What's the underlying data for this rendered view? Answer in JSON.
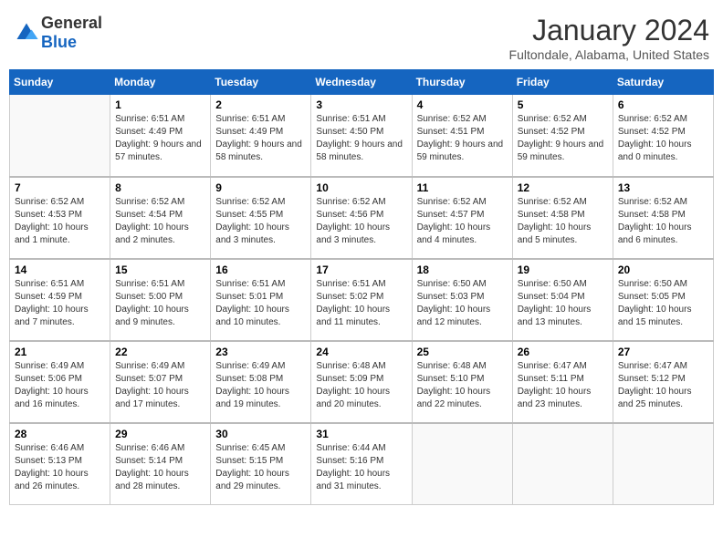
{
  "header": {
    "logo": {
      "general": "General",
      "blue": "Blue"
    },
    "title": "January 2024",
    "location": "Fultondale, Alabama, United States"
  },
  "days_of_week": [
    "Sunday",
    "Monday",
    "Tuesday",
    "Wednesday",
    "Thursday",
    "Friday",
    "Saturday"
  ],
  "weeks": [
    [
      {
        "day": "",
        "sunrise": "",
        "sunset": "",
        "daylight": ""
      },
      {
        "day": "1",
        "sunrise": "Sunrise: 6:51 AM",
        "sunset": "Sunset: 4:49 PM",
        "daylight": "Daylight: 9 hours and 57 minutes."
      },
      {
        "day": "2",
        "sunrise": "Sunrise: 6:51 AM",
        "sunset": "Sunset: 4:49 PM",
        "daylight": "Daylight: 9 hours and 58 minutes."
      },
      {
        "day": "3",
        "sunrise": "Sunrise: 6:51 AM",
        "sunset": "Sunset: 4:50 PM",
        "daylight": "Daylight: 9 hours and 58 minutes."
      },
      {
        "day": "4",
        "sunrise": "Sunrise: 6:52 AM",
        "sunset": "Sunset: 4:51 PM",
        "daylight": "Daylight: 9 hours and 59 minutes."
      },
      {
        "day": "5",
        "sunrise": "Sunrise: 6:52 AM",
        "sunset": "Sunset: 4:52 PM",
        "daylight": "Daylight: 9 hours and 59 minutes."
      },
      {
        "day": "6",
        "sunrise": "Sunrise: 6:52 AM",
        "sunset": "Sunset: 4:52 PM",
        "daylight": "Daylight: 10 hours and 0 minutes."
      }
    ],
    [
      {
        "day": "7",
        "sunrise": "Sunrise: 6:52 AM",
        "sunset": "Sunset: 4:53 PM",
        "daylight": "Daylight: 10 hours and 1 minute."
      },
      {
        "day": "8",
        "sunrise": "Sunrise: 6:52 AM",
        "sunset": "Sunset: 4:54 PM",
        "daylight": "Daylight: 10 hours and 2 minutes."
      },
      {
        "day": "9",
        "sunrise": "Sunrise: 6:52 AM",
        "sunset": "Sunset: 4:55 PM",
        "daylight": "Daylight: 10 hours and 3 minutes."
      },
      {
        "day": "10",
        "sunrise": "Sunrise: 6:52 AM",
        "sunset": "Sunset: 4:56 PM",
        "daylight": "Daylight: 10 hours and 3 minutes."
      },
      {
        "day": "11",
        "sunrise": "Sunrise: 6:52 AM",
        "sunset": "Sunset: 4:57 PM",
        "daylight": "Daylight: 10 hours and 4 minutes."
      },
      {
        "day": "12",
        "sunrise": "Sunrise: 6:52 AM",
        "sunset": "Sunset: 4:58 PM",
        "daylight": "Daylight: 10 hours and 5 minutes."
      },
      {
        "day": "13",
        "sunrise": "Sunrise: 6:52 AM",
        "sunset": "Sunset: 4:58 PM",
        "daylight": "Daylight: 10 hours and 6 minutes."
      }
    ],
    [
      {
        "day": "14",
        "sunrise": "Sunrise: 6:51 AM",
        "sunset": "Sunset: 4:59 PM",
        "daylight": "Daylight: 10 hours and 7 minutes."
      },
      {
        "day": "15",
        "sunrise": "Sunrise: 6:51 AM",
        "sunset": "Sunset: 5:00 PM",
        "daylight": "Daylight: 10 hours and 9 minutes."
      },
      {
        "day": "16",
        "sunrise": "Sunrise: 6:51 AM",
        "sunset": "Sunset: 5:01 PM",
        "daylight": "Daylight: 10 hours and 10 minutes."
      },
      {
        "day": "17",
        "sunrise": "Sunrise: 6:51 AM",
        "sunset": "Sunset: 5:02 PM",
        "daylight": "Daylight: 10 hours and 11 minutes."
      },
      {
        "day": "18",
        "sunrise": "Sunrise: 6:50 AM",
        "sunset": "Sunset: 5:03 PM",
        "daylight": "Daylight: 10 hours and 12 minutes."
      },
      {
        "day": "19",
        "sunrise": "Sunrise: 6:50 AM",
        "sunset": "Sunset: 5:04 PM",
        "daylight": "Daylight: 10 hours and 13 minutes."
      },
      {
        "day": "20",
        "sunrise": "Sunrise: 6:50 AM",
        "sunset": "Sunset: 5:05 PM",
        "daylight": "Daylight: 10 hours and 15 minutes."
      }
    ],
    [
      {
        "day": "21",
        "sunrise": "Sunrise: 6:49 AM",
        "sunset": "Sunset: 5:06 PM",
        "daylight": "Daylight: 10 hours and 16 minutes."
      },
      {
        "day": "22",
        "sunrise": "Sunrise: 6:49 AM",
        "sunset": "Sunset: 5:07 PM",
        "daylight": "Daylight: 10 hours and 17 minutes."
      },
      {
        "day": "23",
        "sunrise": "Sunrise: 6:49 AM",
        "sunset": "Sunset: 5:08 PM",
        "daylight": "Daylight: 10 hours and 19 minutes."
      },
      {
        "day": "24",
        "sunrise": "Sunrise: 6:48 AM",
        "sunset": "Sunset: 5:09 PM",
        "daylight": "Daylight: 10 hours and 20 minutes."
      },
      {
        "day": "25",
        "sunrise": "Sunrise: 6:48 AM",
        "sunset": "Sunset: 5:10 PM",
        "daylight": "Daylight: 10 hours and 22 minutes."
      },
      {
        "day": "26",
        "sunrise": "Sunrise: 6:47 AM",
        "sunset": "Sunset: 5:11 PM",
        "daylight": "Daylight: 10 hours and 23 minutes."
      },
      {
        "day": "27",
        "sunrise": "Sunrise: 6:47 AM",
        "sunset": "Sunset: 5:12 PM",
        "daylight": "Daylight: 10 hours and 25 minutes."
      }
    ],
    [
      {
        "day": "28",
        "sunrise": "Sunrise: 6:46 AM",
        "sunset": "Sunset: 5:13 PM",
        "daylight": "Daylight: 10 hours and 26 minutes."
      },
      {
        "day": "29",
        "sunrise": "Sunrise: 6:46 AM",
        "sunset": "Sunset: 5:14 PM",
        "daylight": "Daylight: 10 hours and 28 minutes."
      },
      {
        "day": "30",
        "sunrise": "Sunrise: 6:45 AM",
        "sunset": "Sunset: 5:15 PM",
        "daylight": "Daylight: 10 hours and 29 minutes."
      },
      {
        "day": "31",
        "sunrise": "Sunrise: 6:44 AM",
        "sunset": "Sunset: 5:16 PM",
        "daylight": "Daylight: 10 hours and 31 minutes."
      },
      {
        "day": "",
        "sunrise": "",
        "sunset": "",
        "daylight": ""
      },
      {
        "day": "",
        "sunrise": "",
        "sunset": "",
        "daylight": ""
      },
      {
        "day": "",
        "sunrise": "",
        "sunset": "",
        "daylight": ""
      }
    ]
  ]
}
